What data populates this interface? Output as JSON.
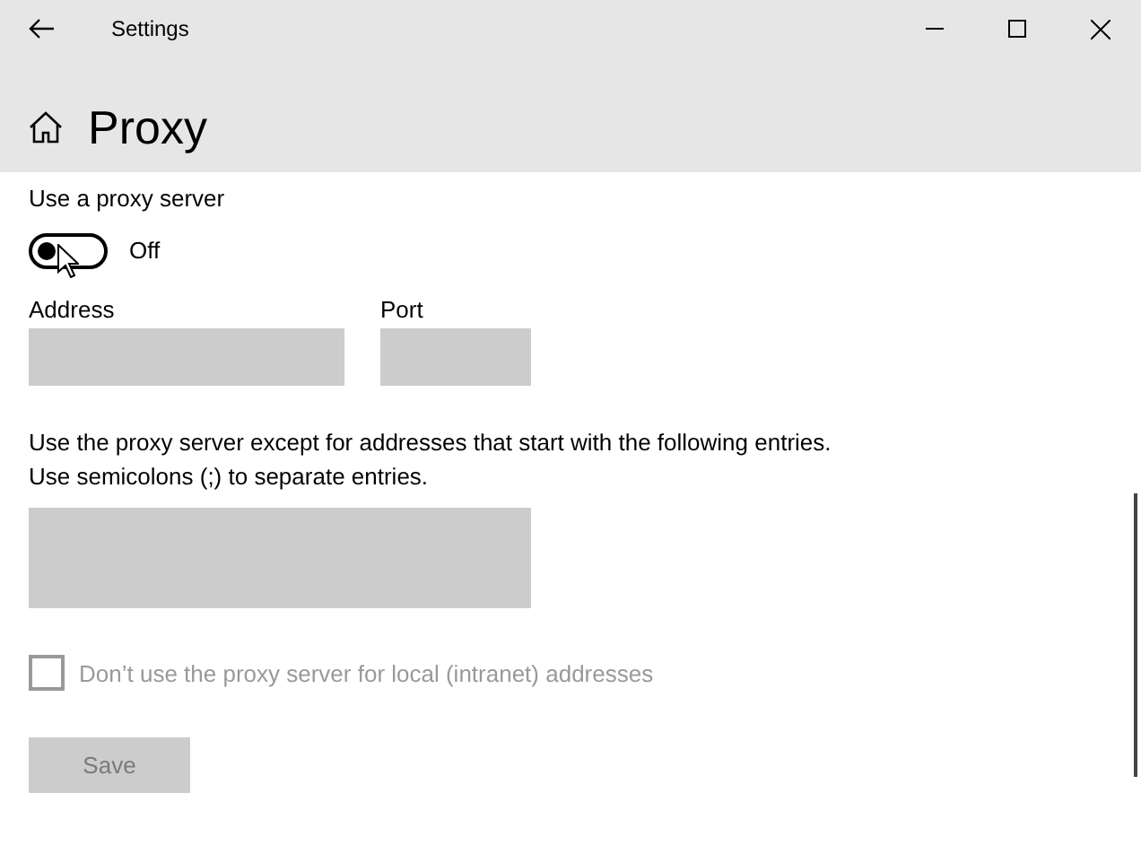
{
  "window": {
    "title": "Settings"
  },
  "page": {
    "title": "Proxy"
  },
  "proxy_toggle": {
    "label": "Use a proxy server",
    "on": false,
    "state_text": "Off"
  },
  "fields": [
    {
      "label": "Address",
      "disabled": true
    },
    {
      "label": "Port",
      "disabled": true
    }
  ],
  "exceptions": {
    "description": "Use the proxy server except for addresses that start with the following entries. Use semicolons (;) to separate entries.",
    "disabled": true
  },
  "local_bypass": {
    "label": "Don’t use the proxy server for local (intranet) addresses",
    "checked": false,
    "disabled": true
  },
  "save_button": {
    "label": "Save",
    "disabled": true
  }
}
